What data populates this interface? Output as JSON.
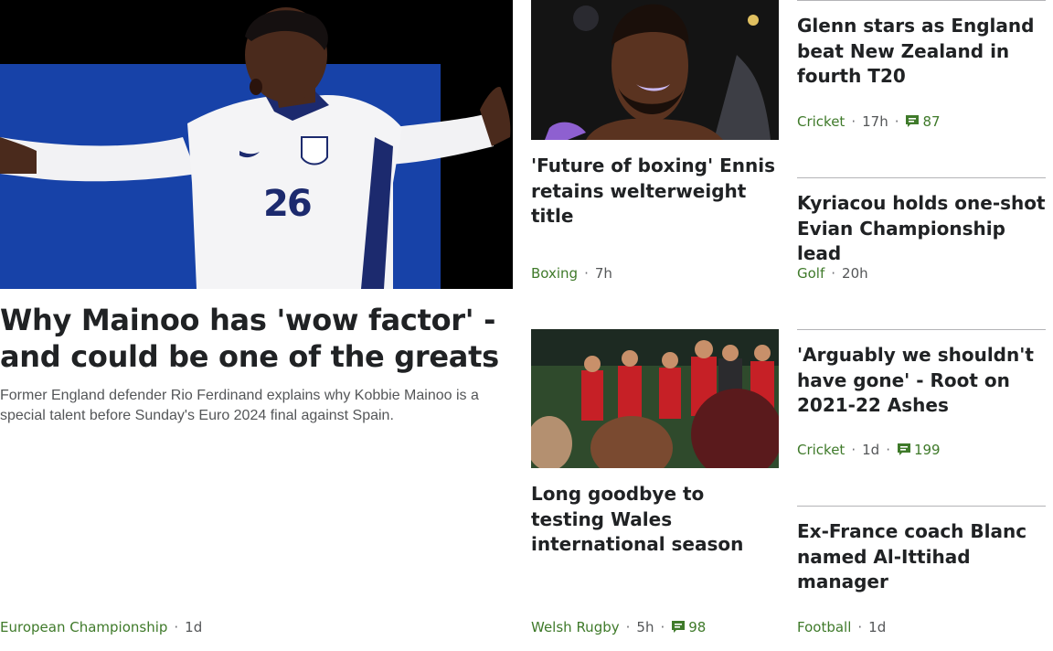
{
  "lead": {
    "headline": "Why Mainoo has 'wow factor' - and could be one of the greats",
    "summary": "Former England defender Rio Ferdinand explains why Kobbie Mainoo is a special talent before Sunday's Euro 2024 final against Spain.",
    "topic": "European Championship",
    "time": "1d",
    "shirt_number": "26",
    "colors": {
      "background": "#1742a8",
      "topic": "#3f7a2a"
    }
  },
  "stories": [
    {
      "headline": "'Future of boxing' Ennis retains welterweight title",
      "topic": "Boxing",
      "time": "7h"
    },
    {
      "headline": "Long goodbye to testing Wales international season",
      "topic": "Welsh Rugby",
      "time": "5h",
      "comments": "98"
    },
    {
      "headline": "Glenn stars as England beat New Zealand in fourth T20",
      "topic": "Cricket",
      "time": "17h",
      "comments": "87"
    },
    {
      "headline": "Kyriacou holds one-shot Evian Championship lead",
      "topic": "Golf",
      "time": "20h"
    },
    {
      "headline": "'Arguably we shouldn't have gone' - Root on 2021-22 Ashes",
      "topic": "Cricket",
      "time": "1d",
      "comments": "199"
    },
    {
      "headline": "Ex-France coach Blanc named Al-Ittihad manager",
      "topic": "Football",
      "time": "1d"
    }
  ],
  "separator": "·",
  "icons": {
    "comments": "speech-bubble-icon"
  }
}
